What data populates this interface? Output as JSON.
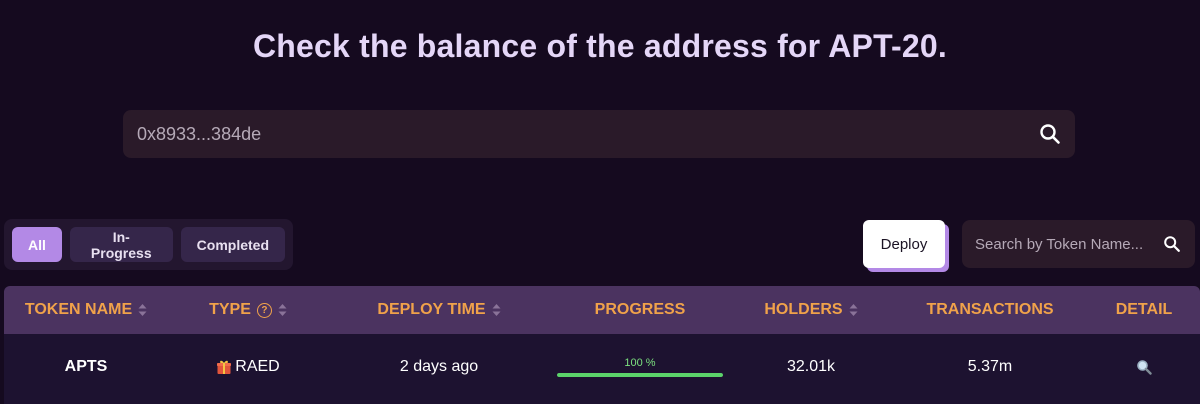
{
  "hero": {
    "title": "Check the balance of the address for APT-20."
  },
  "address_search": {
    "value": "0x8933...384de"
  },
  "filters": [
    {
      "label": "All",
      "active": true
    },
    {
      "label": "In-Progress",
      "active": false
    },
    {
      "label": "Completed",
      "active": false
    }
  ],
  "deploy_label": "Deploy",
  "token_search": {
    "placeholder": "Search by Token Name..."
  },
  "table": {
    "headers": {
      "token_name": "TOKEN NAME",
      "type": "TYPE",
      "deploy_time": "DEPLOY TIME",
      "progress": "PROGRESS",
      "holders": "HOLDERS",
      "transactions": "TRANSACTIONS",
      "detail": "DETAIL"
    },
    "rows": [
      {
        "token_name": "APTS",
        "type": "RAED",
        "type_icon": "gift-icon",
        "deploy_time": "2 days ago",
        "progress_label": "100 %",
        "progress": 1.0,
        "holders": "32.01k",
        "transactions": "5.37m",
        "detail_icon": "magnifier-icon"
      }
    ]
  },
  "colors": {
    "background": "#150a1f",
    "accent": "#b389e6",
    "header_text": "#f0a24a",
    "progress": "#5bd36a"
  }
}
